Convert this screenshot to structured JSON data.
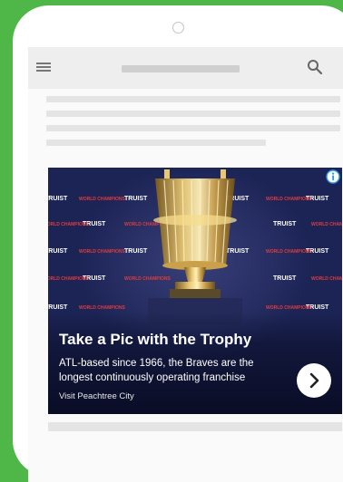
{
  "ad": {
    "headline": "Take a Pic with the Trophy",
    "body": "ATL-based since 1966, the Braves are the longest continuously operating franchise",
    "cta": "Visit Peachtree City",
    "backdrop_texts": [
      "TRUIST",
      "WORLD CHAMPIONS"
    ]
  },
  "colors": {
    "background": "#4fb747",
    "phone": "#ffffff",
    "appbar": "#eeeeee",
    "ad_backdrop": "#1c2456",
    "info_icon": "#2196f3"
  },
  "icons": [
    "menu-icon",
    "search-icon",
    "info-icon",
    "chevron-right-icon",
    "trophy-image"
  ]
}
